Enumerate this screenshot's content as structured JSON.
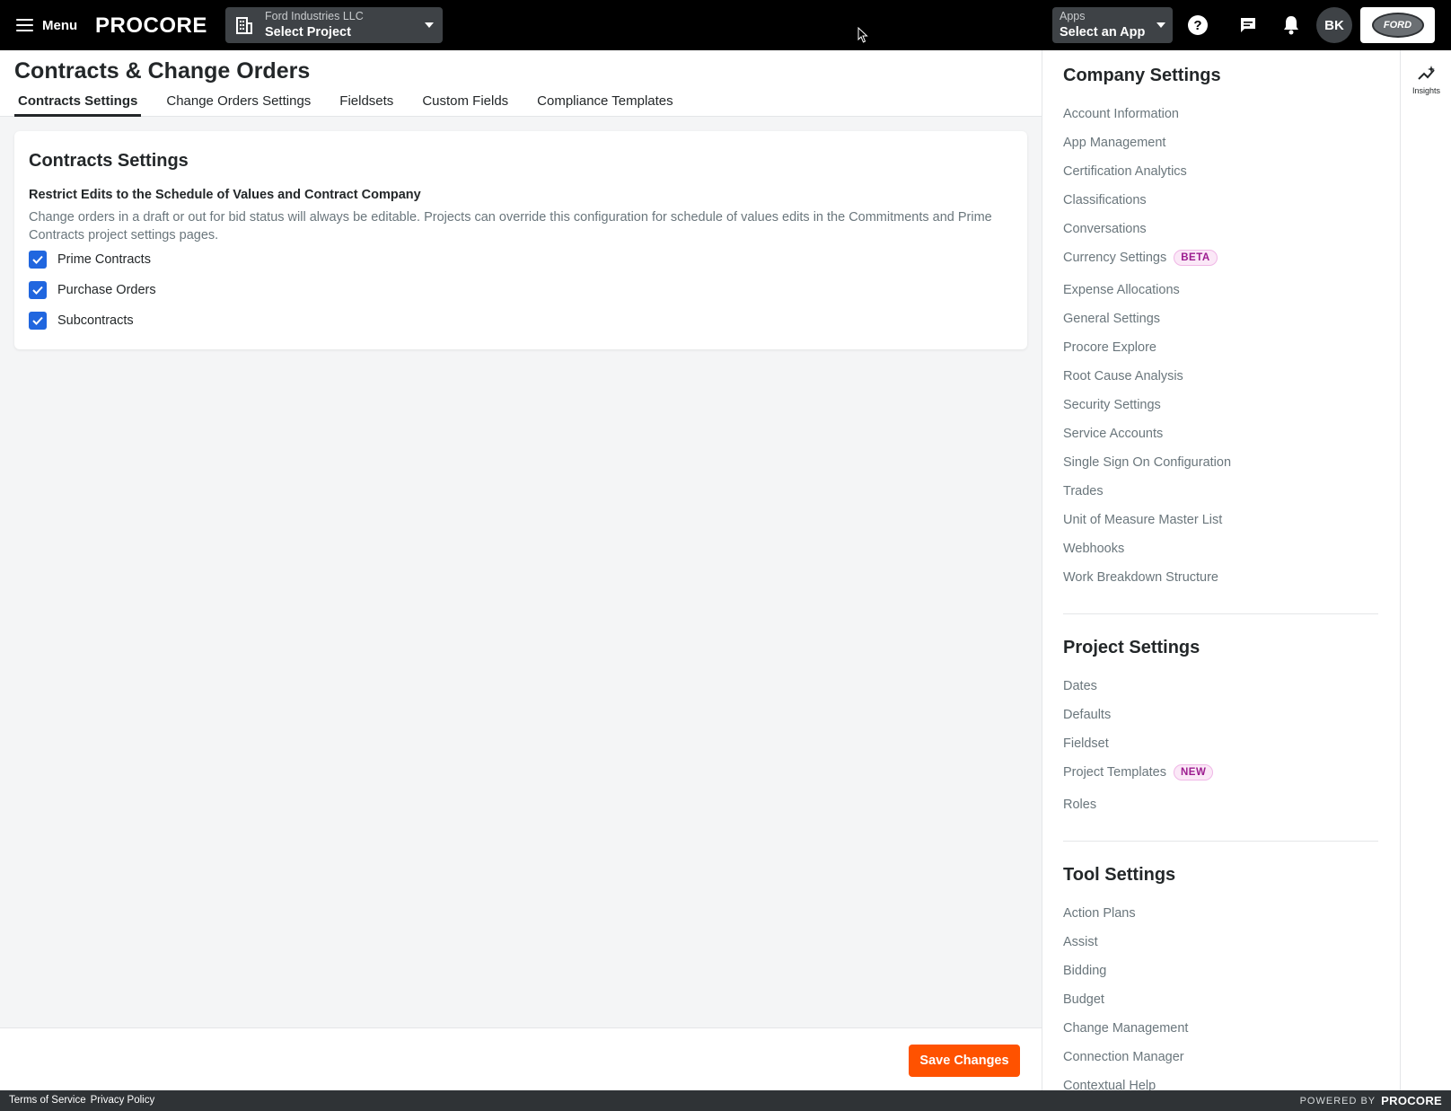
{
  "topbar": {
    "menu_label": "Menu",
    "logo_text": "PROCORE",
    "project_selector": {
      "company": "Ford Industries LLC",
      "value": "Select Project"
    },
    "apps_selector": {
      "label": "Apps",
      "value": "Select an App"
    },
    "avatar_initials": "BK",
    "company_logo_text": "FORD"
  },
  "page": {
    "title": "Contracts & Change Orders",
    "tabs": [
      {
        "label": "Contracts Settings",
        "active": true
      },
      {
        "label": "Change Orders Settings",
        "active": false
      },
      {
        "label": "Fieldsets",
        "active": false
      },
      {
        "label": "Custom Fields",
        "active": false
      },
      {
        "label": "Compliance Templates",
        "active": false
      }
    ]
  },
  "card": {
    "title": "Contracts Settings",
    "section_label": "Restrict Edits to the Schedule of Values and Contract Company",
    "section_description": "Change orders in a draft or out for bid status will always be editable. Projects can override this configuration for schedule of values edits in the Commitments and Prime Contracts project settings pages.",
    "checkboxes": [
      {
        "label": "Prime Contracts",
        "checked": true
      },
      {
        "label": "Purchase Orders",
        "checked": true
      },
      {
        "label": "Subcontracts",
        "checked": true
      }
    ]
  },
  "save_button_label": "Save Changes",
  "sidebar": {
    "company_heading": "Company Settings",
    "company_items": [
      {
        "label": "Account Information"
      },
      {
        "label": "App Management"
      },
      {
        "label": "Certification Analytics"
      },
      {
        "label": "Classifications"
      },
      {
        "label": "Conversations"
      },
      {
        "label": "Currency Settings",
        "badge": "BETA"
      },
      {
        "label": "Expense Allocations"
      },
      {
        "label": "General Settings"
      },
      {
        "label": "Procore Explore"
      },
      {
        "label": "Root Cause Analysis"
      },
      {
        "label": "Security Settings"
      },
      {
        "label": "Service Accounts"
      },
      {
        "label": "Single Sign On Configuration"
      },
      {
        "label": "Trades"
      },
      {
        "label": "Unit of Measure Master List"
      },
      {
        "label": "Webhooks"
      },
      {
        "label": "Work Breakdown Structure"
      }
    ],
    "project_heading": "Project Settings",
    "project_items": [
      {
        "label": "Dates"
      },
      {
        "label": "Defaults"
      },
      {
        "label": "Fieldset"
      },
      {
        "label": "Project Templates",
        "badge": "NEW"
      },
      {
        "label": "Roles"
      }
    ],
    "tool_heading": "Tool Settings",
    "tool_items": [
      {
        "label": "Action Plans"
      },
      {
        "label": "Assist"
      },
      {
        "label": "Bidding"
      },
      {
        "label": "Budget"
      },
      {
        "label": "Change Management"
      },
      {
        "label": "Connection Manager"
      },
      {
        "label": "Contextual Help"
      }
    ]
  },
  "rail": {
    "insights_label": "Insights"
  },
  "footer": {
    "terms": "Terms of Service",
    "privacy": "Privacy Policy",
    "powered_by": "POWERED BY",
    "powered_brand": "PROCORE"
  },
  "colors": {
    "topbar": "#000000",
    "accent_orange": "#ff5200",
    "checkbox_blue": "#2066df",
    "badge_text": "#9c1c8f"
  },
  "icons": {
    "menu": "hamburger-icon",
    "project": "building-icon",
    "help": "help-circle-icon",
    "chat": "chat-icon",
    "notifications": "bell-icon",
    "insights": "sparkle-chart-icon",
    "check": "check-icon"
  }
}
